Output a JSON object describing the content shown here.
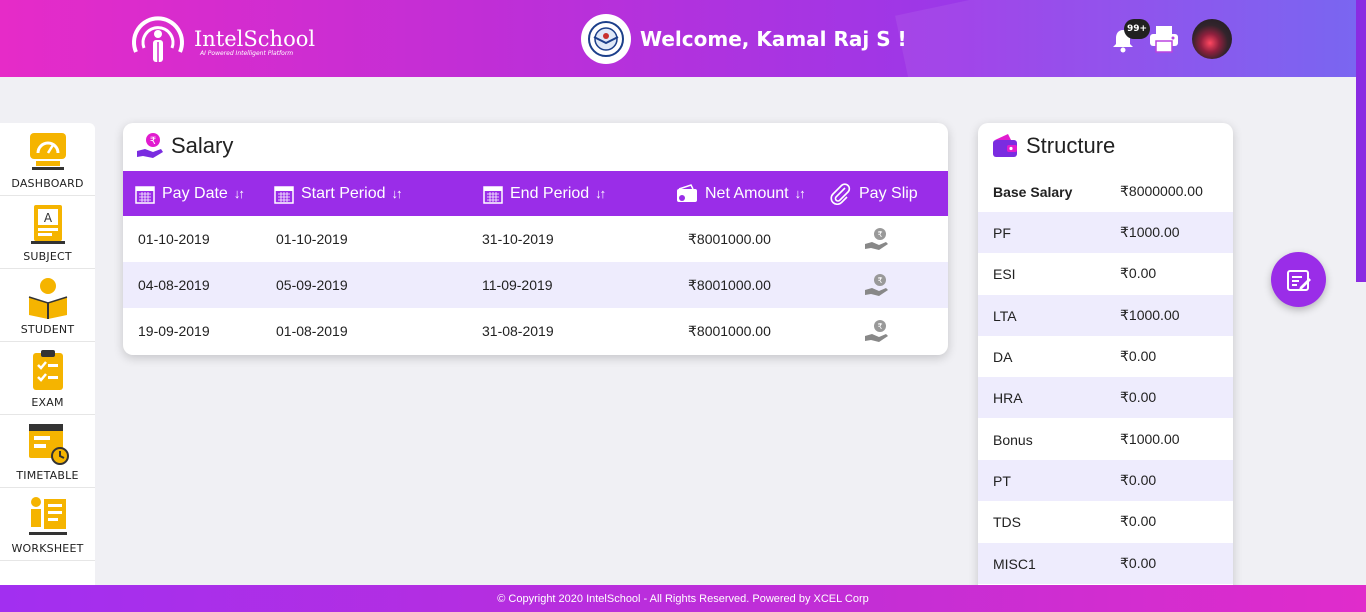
{
  "header": {
    "logo_name": "IntelSchool",
    "logo_tagline": "AI Powered Intelligent Platform",
    "welcome": "Welcome, Kamal Raj S !",
    "notification_count": "99+",
    "accent": "#9a2de8"
  },
  "sidebar": {
    "items": [
      {
        "label": "DASHBOARD",
        "icon": "dashboard-icon"
      },
      {
        "label": "SUBJECT",
        "icon": "subject-book-icon"
      },
      {
        "label": "STUDENT",
        "icon": "student-reading-icon"
      },
      {
        "label": "EXAM",
        "icon": "exam-clipboard-icon"
      },
      {
        "label": "TIMETABLE",
        "icon": "timetable-icon"
      },
      {
        "label": "WORKSHEET",
        "icon": "worksheet-icon"
      }
    ]
  },
  "salary": {
    "title": "Salary",
    "columns": [
      "Pay Date",
      "Start Period",
      "End Period",
      "Net Amount",
      "Pay Slip"
    ],
    "rows": [
      {
        "pay_date": "01-10-2019",
        "start": "01-10-2019",
        "end": "31-10-2019",
        "net": "₹8001000.00"
      },
      {
        "pay_date": "04-08-2019",
        "start": "05-09-2019",
        "end": "11-09-2019",
        "net": "₹8001000.00"
      },
      {
        "pay_date": "19-09-2019",
        "start": "01-08-2019",
        "end": "31-08-2019",
        "net": "₹8001000.00"
      }
    ]
  },
  "structure": {
    "title": "Structure",
    "rows": [
      {
        "name": "Base Salary",
        "value": "₹8000000.00"
      },
      {
        "name": "PF",
        "value": "₹1000.00"
      },
      {
        "name": "ESI",
        "value": "₹0.00"
      },
      {
        "name": "LTA",
        "value": "₹1000.00"
      },
      {
        "name": "DA",
        "value": "₹0.00"
      },
      {
        "name": "HRA",
        "value": "₹0.00"
      },
      {
        "name": "Bonus",
        "value": "₹1000.00"
      },
      {
        "name": "PT",
        "value": "₹0.00"
      },
      {
        "name": "TDS",
        "value": "₹0.00"
      },
      {
        "name": "MISC1",
        "value": "₹0.00"
      }
    ]
  },
  "footer": {
    "text": "© Copyright 2020 IntelSchool - All Rights Reserved. Powered by XCEL Corp"
  }
}
